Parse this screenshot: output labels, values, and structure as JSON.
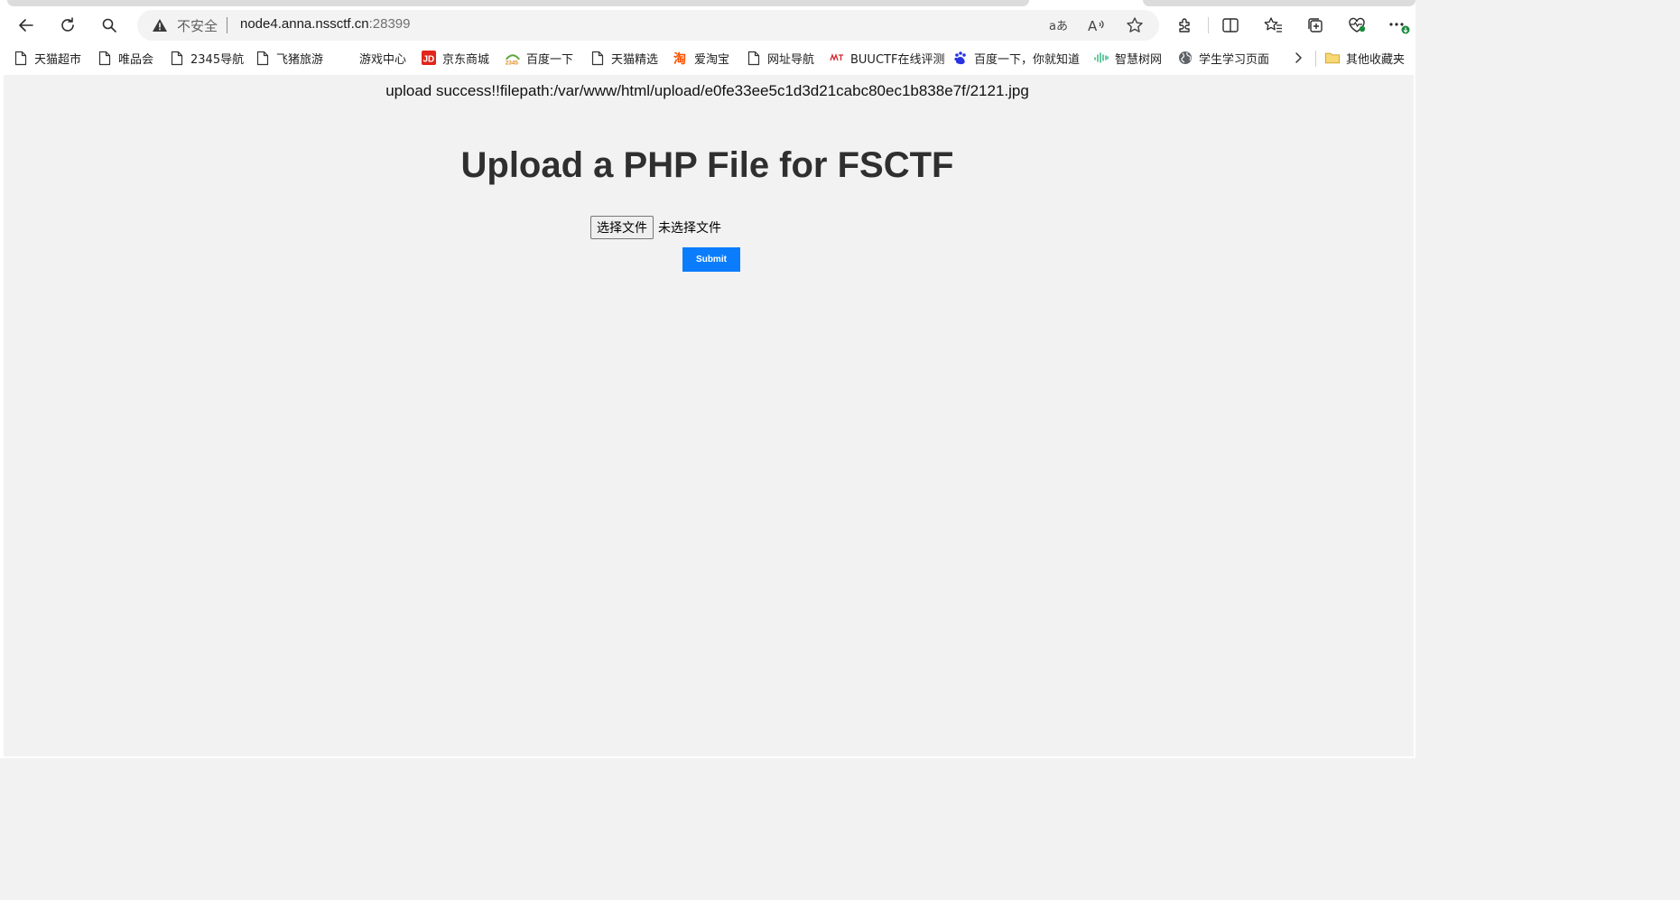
{
  "browser": {
    "address_bar": {
      "security_label": "不安全",
      "host": "node4.anna.nssctf.cn",
      "port": ":28399"
    },
    "toolbar_icons": [
      "back-icon",
      "refresh-icon",
      "search-icon",
      "translate-icon",
      "read-aloud-icon",
      "favorite-star-icon",
      "extensions-icon",
      "split-screen-icon",
      "favorites-icon",
      "collections-icon",
      "browser-essentials-icon",
      "more-icon"
    ],
    "bookmarks": [
      {
        "label": "天猫超市",
        "icon": "page-icon"
      },
      {
        "label": "唯品会",
        "icon": "page-icon"
      },
      {
        "label": "2345导航",
        "icon": "page-icon"
      },
      {
        "label": "飞猪旅游",
        "icon": "page-icon"
      },
      {
        "label": "游戏中心",
        "icon": "none"
      },
      {
        "label": "京东商城",
        "icon": "jd-logo-icon"
      },
      {
        "label": "百度一下",
        "icon": "2345-logo-icon"
      },
      {
        "label": "天猫精选",
        "icon": "page-icon"
      },
      {
        "label": "爱淘宝",
        "icon": "taobao-logo-icon"
      },
      {
        "label": "网址导航",
        "icon": "page-icon"
      },
      {
        "label": "BUUCTF在线评测",
        "icon": "buuctf-logo-icon"
      },
      {
        "label": "百度一下，你就知道",
        "icon": "baidu-paw-icon"
      },
      {
        "label": "智慧树网",
        "icon": "zhihuishu-logo-icon"
      },
      {
        "label": "学生学习页面",
        "icon": "globe-icon"
      }
    ],
    "other_bookmarks": "其他收藏夹"
  },
  "page": {
    "upload_message": "upload success!!filepath:/var/www/html/upload/e0fe33ee5c1d3d21cabc80ec1b838e7f/2121.jpg",
    "title": "Upload a PHP File for FSCTF",
    "file_input": {
      "button_label": "选择文件",
      "status": "未选择文件"
    },
    "submit_label": "Submit"
  },
  "colors": {
    "page_background": "#f2f2f2",
    "submit_background": "#0b7dfc",
    "title_text": "#2f2f2f"
  }
}
